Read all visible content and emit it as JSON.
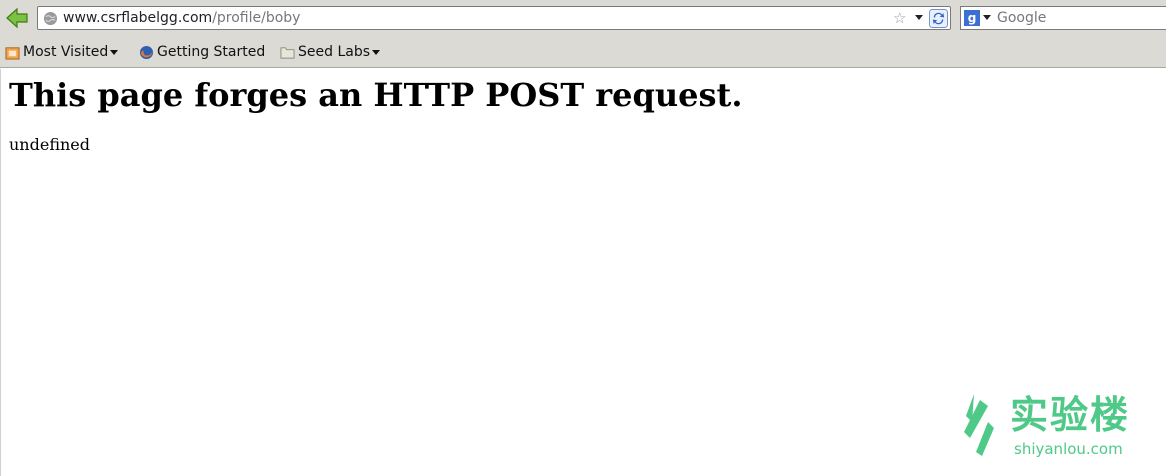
{
  "navbar": {
    "url_host": "www.csrflabelgg.com",
    "url_path": "/profile/boby",
    "search_engine_letter": "g",
    "search_placeholder": "Google"
  },
  "bookmarks": [
    {
      "label": "Most Visited",
      "icon": "most-visited-icon"
    },
    {
      "label": "Getting Started",
      "icon": "firefox-icon"
    },
    {
      "label": "Seed Labs",
      "icon": "folder-icon"
    }
  ],
  "page": {
    "heading": "This page forges an HTTP POST request.",
    "result_text": "undefined"
  },
  "watermark": {
    "brand_cn": "实验楼",
    "brand_en": "shiyanlou.com",
    "color": "#4fc987"
  },
  "colors": {
    "chrome": "#dcdad5",
    "back_arrow": "#5fa02a"
  }
}
